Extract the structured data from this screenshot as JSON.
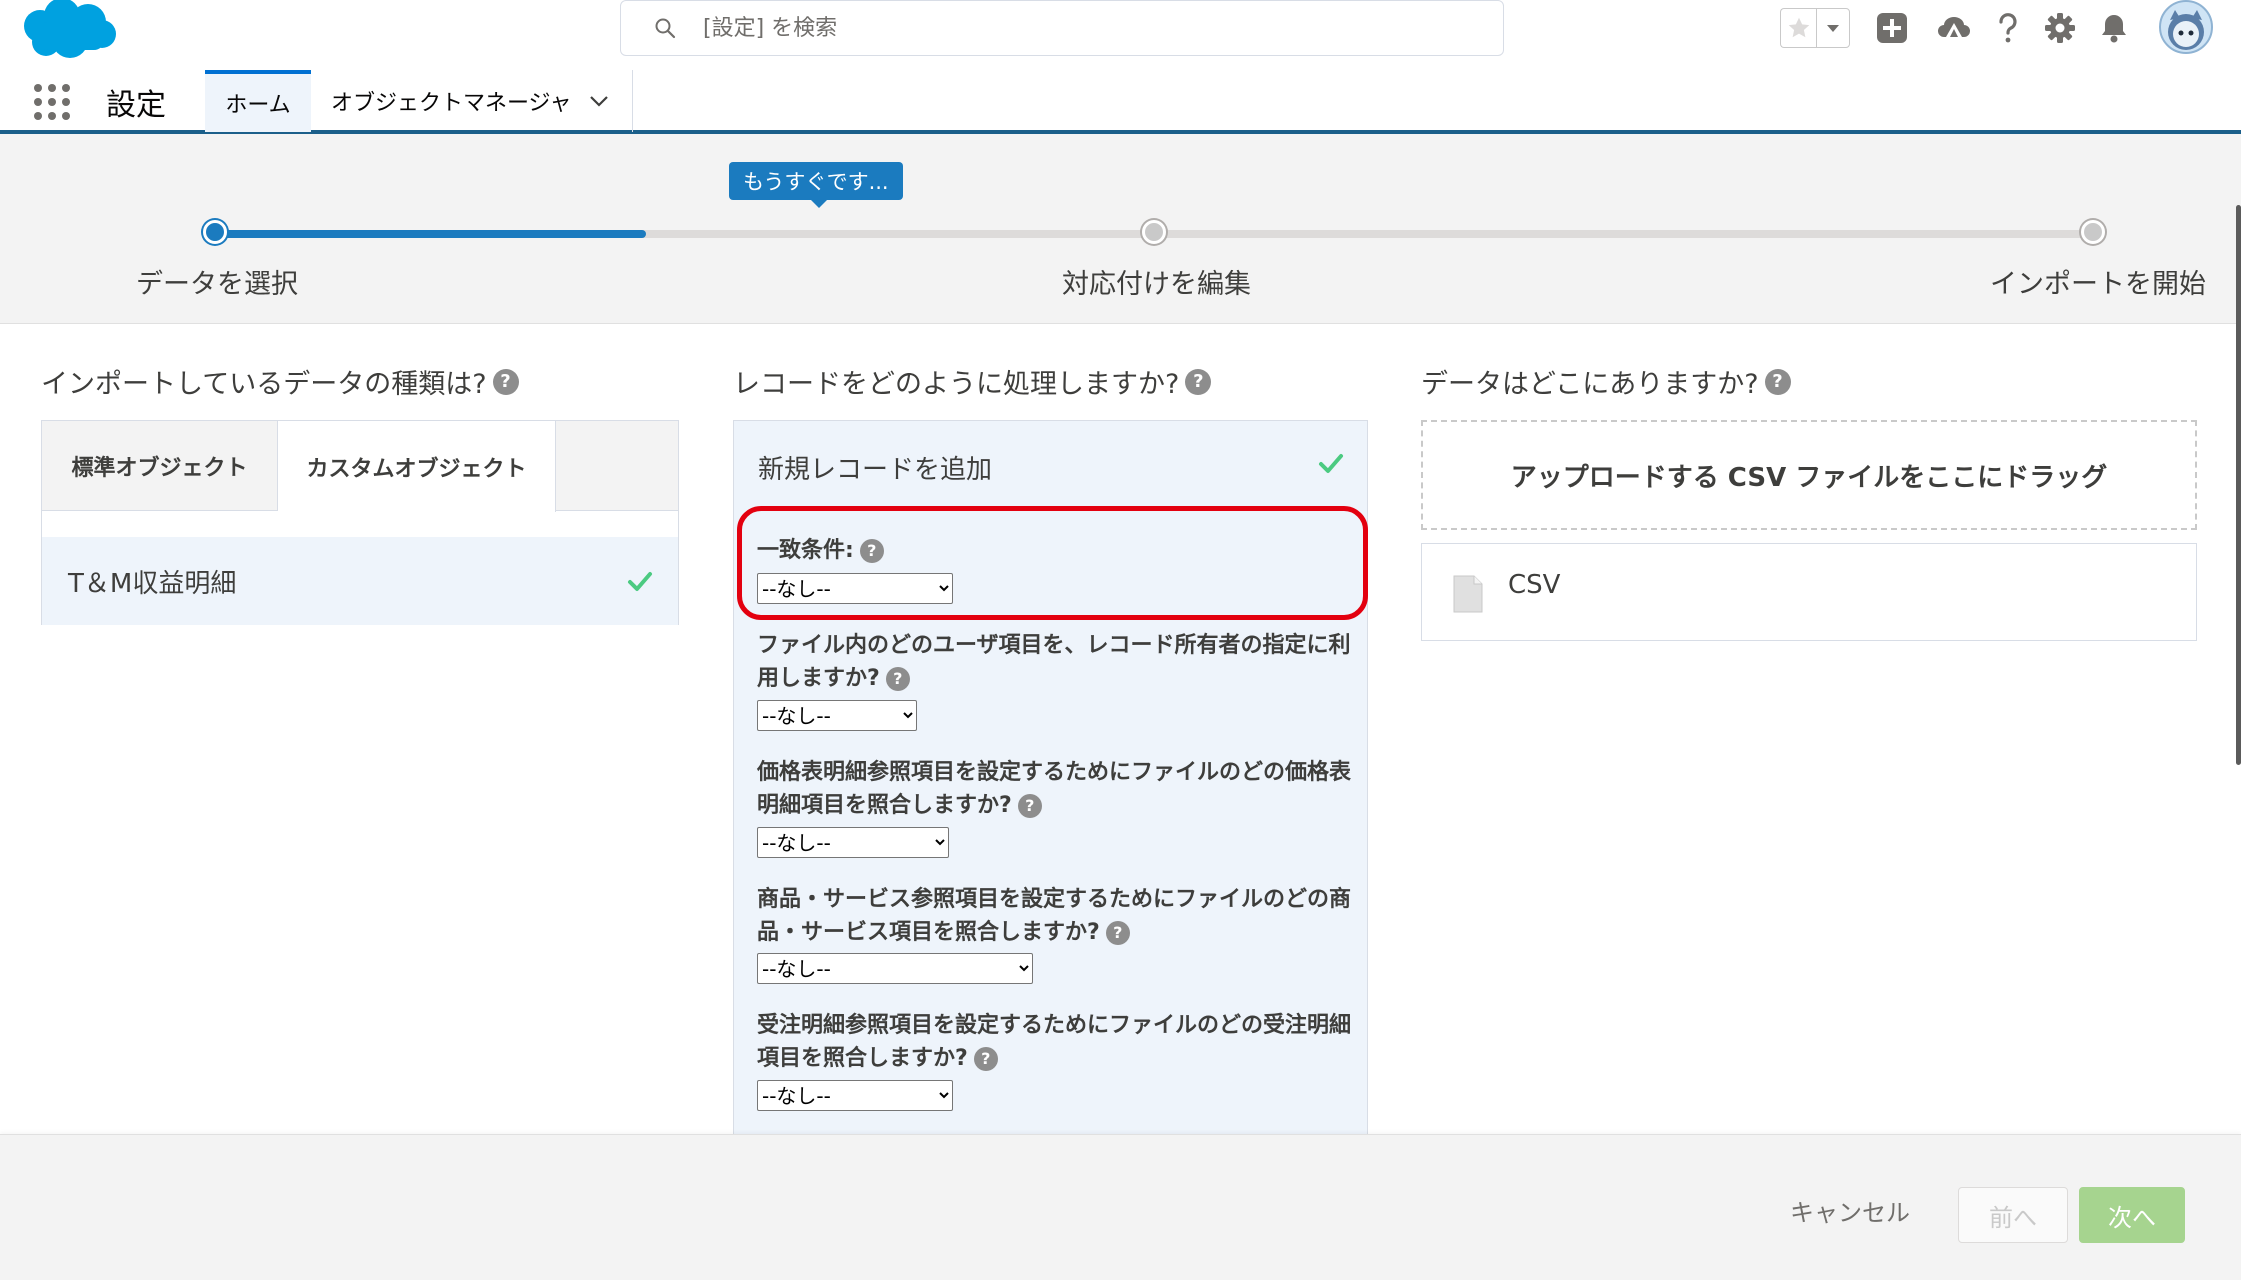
{
  "header": {
    "search_placeholder": "[設定] を検索",
    "icons": [
      "salesforce-cloud-logo",
      "search-icon",
      "star-icon",
      "chevron-down-icon",
      "add-icon",
      "trailhead-icon",
      "help-icon",
      "gear-icon",
      "bell-icon",
      "avatar"
    ]
  },
  "nav": {
    "app_name": "設定",
    "tabs": [
      {
        "label": "ホーム"
      },
      {
        "label": "オブジェクトマネージャ"
      }
    ]
  },
  "wizard": {
    "tooltip": "もうすぐです...",
    "progress": 0.23,
    "steps": [
      {
        "label": "データを選択"
      },
      {
        "label": "対応付けを編集"
      },
      {
        "label": "インポートを開始"
      }
    ]
  },
  "left": {
    "heading": "インポートしているデータの種類は?",
    "tabs": [
      {
        "label": "標準オブジェクト"
      },
      {
        "label": "カスタムオブジェクト"
      }
    ],
    "selected_object": "T＆M収益明細"
  },
  "middle": {
    "heading": "レコードをどのように処理しますか?",
    "selected_action": "新規レコードを追加",
    "fields": [
      {
        "label": "一致条件:",
        "value": "--なし--"
      },
      {
        "label_line1": "ファイル内のどのユーザ項目を、レコード所有者の指定に利",
        "label_line2": "用しますか?",
        "value": "--なし--"
      },
      {
        "label_line1": "価格表明細参照項目を設定するためにファイルのどの価格表",
        "label_line2": "明細項目を照合しますか?",
        "value": "--なし--"
      },
      {
        "label_line1": "商品・サービス参照項目を設定するためにファイルのどの商",
        "label_line2": "品・サービス項目を照合しますか?",
        "value": "--なし--"
      },
      {
        "label_line1": "受注明細参照項目を設定するためにファイルのどの受注明細",
        "label_line2": "項目を照合しますか?",
        "value": "--なし--"
      }
    ]
  },
  "right": {
    "heading": "データはどこにありますか?",
    "drop_zone": "アップロードする CSV ファイルをここにドラッグ",
    "file_type": "CSV"
  },
  "footer": {
    "cancel": "キャンセル",
    "prev": "前へ",
    "next": "次へ"
  },
  "colors": {
    "brand_blue": "#1b7bbf",
    "highlight_red": "#e3000f",
    "check_green": "#4bca81",
    "next_button": "#a6d48f"
  }
}
